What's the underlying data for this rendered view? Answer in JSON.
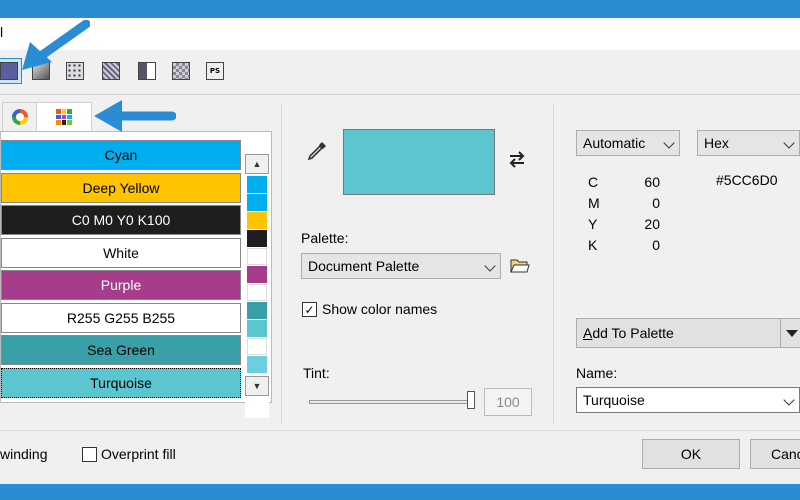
{
  "window": {
    "title_fragment": "l"
  },
  "fill_types": [
    {
      "name": "uniform-fill",
      "selected": true
    },
    {
      "name": "fountain-fill",
      "selected": false
    },
    {
      "name": "vector-pattern-fill",
      "selected": false
    },
    {
      "name": "bitmap-pattern-fill",
      "selected": false
    },
    {
      "name": "two-color-pattern-fill",
      "selected": false
    },
    {
      "name": "texture-fill",
      "selected": false
    },
    {
      "name": "postscript-fill",
      "selected": false
    }
  ],
  "fill_type_ps_text": "PS",
  "model_tabs": [
    {
      "name": "color-viewers",
      "active": false
    },
    {
      "name": "color-harmonies",
      "active": false
    },
    {
      "name": "color-palettes",
      "active": true
    }
  ],
  "palette_rows": [
    {
      "label": "Cyan",
      "bg": "#00AEEF",
      "fg": "#000000",
      "selected": false
    },
    {
      "label": "Deep Yellow",
      "bg": "#FFC300",
      "fg": "#000000",
      "selected": false
    },
    {
      "label": "C0 M0 Y0 K100",
      "bg": "#1E1E1E",
      "fg": "#FFFFFF",
      "selected": false
    },
    {
      "label": "White",
      "bg": "#FFFFFF",
      "fg": "#000000",
      "selected": false
    },
    {
      "label": "Purple",
      "bg": "#A83C8C",
      "fg": "#FFFFFF",
      "selected": false
    },
    {
      "label": "R255 G255 B255",
      "bg": "#FFFFFF",
      "fg": "#000000",
      "selected": false
    },
    {
      "label": "Sea Green",
      "bg": "#3AA0A8",
      "fg": "#000000",
      "selected": false
    },
    {
      "label": "Turquoise",
      "bg": "#5CC6D0",
      "fg": "#000000",
      "selected": true
    }
  ],
  "mini_swatches": [
    "#00AEEF",
    "#00AEEF",
    "#FFC300",
    "#1E1E1E",
    "#FFFFFF",
    "#A83C8C",
    "#FFFFFF",
    "#3AA0A8",
    "#5CC6D0",
    "#FFFFFF",
    "#6CCFE0"
  ],
  "scroll": {
    "up": "▲",
    "down": "▼"
  },
  "preview_color": "#5CC6D0",
  "palette": {
    "label": "Palette:",
    "value": "Document Palette"
  },
  "show_names": {
    "label": "Show color names",
    "checked": true,
    "mark": "✓"
  },
  "tint": {
    "label": "Tint:",
    "value": "100",
    "level_percent": 100
  },
  "model_select": {
    "value": "Automatic"
  },
  "format_select": {
    "value": "Hex"
  },
  "hex_value": "#5CC6D0",
  "cmyk": [
    {
      "k": "C",
      "v": "60"
    },
    {
      "k": "M",
      "v": "0"
    },
    {
      "k": "Y",
      "v": "20"
    },
    {
      "k": "K",
      "v": "0"
    }
  ],
  "add_to_palette": {
    "label_prefix": "A",
    "label_rest": "dd To Palette"
  },
  "name": {
    "label": "Name:",
    "value": "Turquoise"
  },
  "footer": {
    "winding_label": "winding",
    "overprint_label": "Overprint fill",
    "ok": "OK",
    "cancel": "Canc"
  },
  "accent": "#2A8DD4"
}
